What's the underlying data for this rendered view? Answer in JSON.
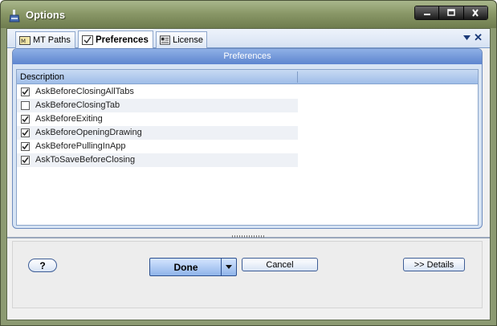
{
  "window": {
    "title": "Options",
    "controls": [
      "minimize-icon",
      "maximize-icon",
      "close-icon"
    ]
  },
  "tabs": [
    {
      "label": "MT Paths",
      "icon": "folder-icon",
      "active": false
    },
    {
      "label": "Preferences",
      "icon": "checkbox-icon",
      "active": true
    },
    {
      "label": "License",
      "icon": "license-card-icon",
      "active": false
    }
  ],
  "panel": {
    "header": "Preferences",
    "column_header": "Description",
    "rows": [
      {
        "label": "AskBeforeClosingAllTabs",
        "checked": true
      },
      {
        "label": "AskBeforeClosingTab",
        "checked": false
      },
      {
        "label": "AskBeforeExiting",
        "checked": true
      },
      {
        "label": "AskBeforeOpeningDrawing",
        "checked": true
      },
      {
        "label": "AskBeforePullingInApp",
        "checked": true
      },
      {
        "label": "AskToSaveBeforeClosing",
        "checked": true
      }
    ]
  },
  "buttons": {
    "help": "?",
    "done": "Done",
    "cancel": "Cancel",
    "details": ">> Details"
  },
  "colors": {
    "title_bar": "#8a9868",
    "panel_header": "#5d85cf",
    "done_button": "#8fb4ea"
  }
}
